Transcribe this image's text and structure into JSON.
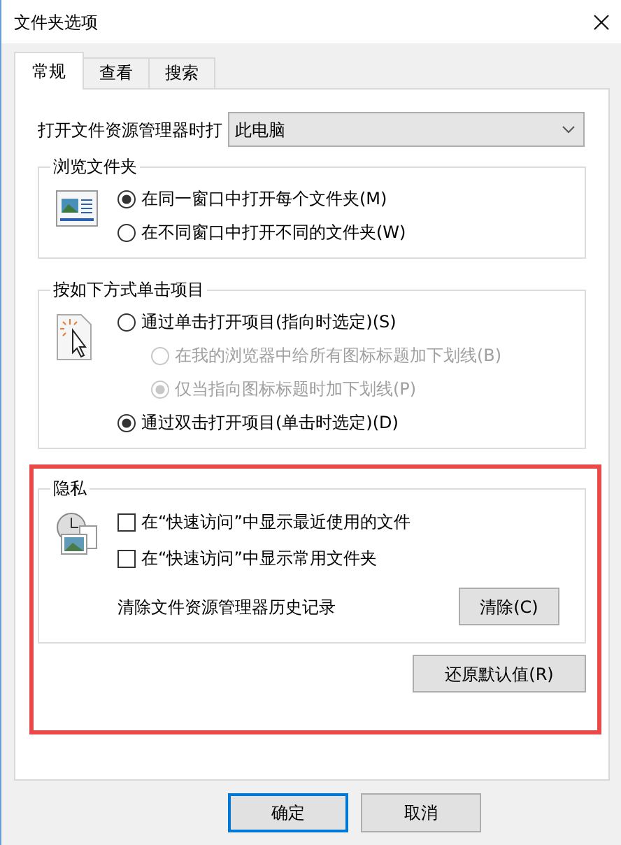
{
  "window": {
    "title": "文件夹选项"
  },
  "tabs": [
    {
      "label": "常规",
      "selected": true
    },
    {
      "label": "查看",
      "selected": false
    },
    {
      "label": "搜索",
      "selected": false
    }
  ],
  "open_explorer": {
    "label": "打开文件资源管理器时打",
    "value": "此电脑"
  },
  "groups": [
    {
      "title": "浏览文件夹",
      "options": [
        {
          "label": "在同一窗口中打开每个文件夹(M)",
          "selected": true,
          "disabled": false
        },
        {
          "label": "在不同窗口中打开不同的文件夹(W)",
          "selected": false,
          "disabled": false
        }
      ]
    },
    {
      "title": "按如下方式单击项目",
      "options": [
        {
          "label": "通过单击打开项目(指向时选定)(S)",
          "selected": false,
          "disabled": false,
          "children": [
            {
              "label": "在我的浏览器中给所有图标标题加下划线(B)",
              "selected": false,
              "disabled": true
            },
            {
              "label": "仅当指向图标标题时加下划线(P)",
              "selected": true,
              "disabled": true
            }
          ]
        },
        {
          "label": "通过双击打开项目(单击时选定)(D)",
          "selected": true,
          "disabled": false
        }
      ]
    }
  ],
  "privacy": {
    "title": "隐私",
    "options": [
      {
        "label": "在“快速访问”中显示最近使用的文件",
        "checked": false
      },
      {
        "label": "在“快速访问”中显示常用文件夹",
        "checked": false
      }
    ],
    "clear_label": "清除文件资源管理器历史记录",
    "clear_button": "清除(C)"
  },
  "restore_button": "还原默认值(R)",
  "buttons": [
    {
      "label": "确定",
      "default": true
    },
    {
      "label": "取消",
      "default": false
    }
  ]
}
